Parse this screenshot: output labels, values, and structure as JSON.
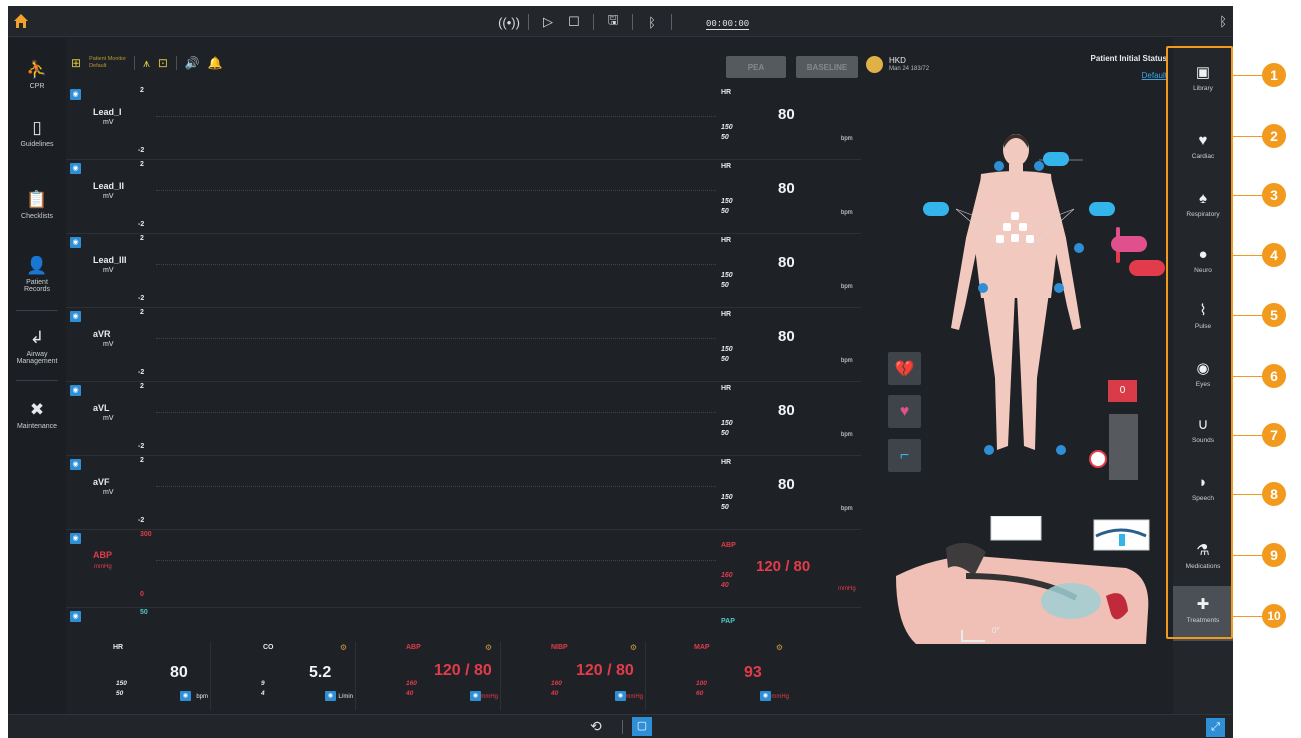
{
  "topbar": {
    "timer": "00:00:00",
    "icons": [
      "home-icon",
      "signal-icon",
      "play-icon",
      "stop-icon",
      "save-icon",
      "bluetooth-icon"
    ]
  },
  "leftnav": {
    "items": [
      {
        "label": "CPR",
        "icon": "cpr-icon"
      },
      {
        "label": "Guidelines",
        "icon": "guidelines-icon"
      },
      {
        "label": "Checklists",
        "icon": "checklist-icon"
      },
      {
        "label": "Patient Records",
        "icon": "patient-records-icon"
      },
      {
        "label": "Airway Management",
        "icon": "airway-icon"
      },
      {
        "label": "Maintenance",
        "icon": "wrench-icon"
      }
    ]
  },
  "monitor": {
    "layout_label": "Patient Monitor",
    "layout_sub": "Default",
    "pea_label": "PEA",
    "baseline_label": "BASELINE"
  },
  "waves": [
    {
      "name": "Lead_I",
      "unit": "mV",
      "top": "2",
      "bottom": "-2",
      "param": "HR",
      "hi": "150",
      "lo": "50",
      "value": "80",
      "punit": "bpm"
    },
    {
      "name": "Lead_II",
      "unit": "mV",
      "top": "2",
      "bottom": "-2",
      "param": "HR",
      "hi": "150",
      "lo": "50",
      "value": "80",
      "punit": "bpm"
    },
    {
      "name": "Lead_III",
      "unit": "mV",
      "top": "2",
      "bottom": "-2",
      "param": "HR",
      "hi": "150",
      "lo": "50",
      "value": "80",
      "punit": "bpm"
    },
    {
      "name": "aVR",
      "unit": "mV",
      "top": "2",
      "bottom": "-2",
      "param": "HR",
      "hi": "150",
      "lo": "50",
      "value": "80",
      "punit": "bpm"
    },
    {
      "name": "aVL",
      "unit": "mV",
      "top": "2",
      "bottom": "-2",
      "param": "HR",
      "hi": "150",
      "lo": "50",
      "value": "80",
      "punit": "bpm"
    },
    {
      "name": "aVF",
      "unit": "mV",
      "top": "2",
      "bottom": "-2",
      "param": "HR",
      "hi": "150",
      "lo": "50",
      "value": "80",
      "punit": "bpm"
    },
    {
      "name": "ABP",
      "unit": "mmHg",
      "top": "300",
      "bottom": "0",
      "param": "ABP",
      "hi": "160",
      "lo": "40",
      "value": "120 / 80",
      "punit": "mmHg"
    }
  ],
  "pap": {
    "top": "50",
    "param": "PAP"
  },
  "bottom_params": [
    {
      "name": "HR",
      "value": "80",
      "hi": "150",
      "lo": "50",
      "unit": "bpm"
    },
    {
      "name": "CO",
      "value": "5.2",
      "hi": "9",
      "lo": "4",
      "unit": "L/min"
    },
    {
      "name": "ABP",
      "value": "120 / 80",
      "hi": "160",
      "lo": "40",
      "unit": "mmHg"
    },
    {
      "name": "NIBP",
      "value": "120 / 80",
      "hi": "160",
      "lo": "40",
      "unit": "mmHg"
    },
    {
      "name": "MAP",
      "value": "93",
      "hi": "100",
      "lo": "60",
      "unit": "mmHg"
    }
  ],
  "patient": {
    "id": "HKD",
    "info": "Man 24 183/72",
    "status_title": "Patient Initial Status",
    "status_value": "Default",
    "gauge_value": "0",
    "head_angle": "0°"
  },
  "rightpanel": {
    "items": [
      {
        "label": "Library",
        "icon": "library-icon"
      },
      {
        "label": "Cardiac",
        "icon": "heart-icon"
      },
      {
        "label": "Respiratory",
        "icon": "lungs-icon"
      },
      {
        "label": "Neuro",
        "icon": "brain-icon"
      },
      {
        "label": "Pulse",
        "icon": "pulse-icon"
      },
      {
        "label": "Eyes",
        "icon": "eye-icon"
      },
      {
        "label": "Sounds",
        "icon": "stethoscope-icon"
      },
      {
        "label": "Speech",
        "icon": "speech-icon"
      },
      {
        "label": "Medications",
        "icon": "medication-icon"
      },
      {
        "label": "Treatments",
        "icon": "treatment-icon"
      }
    ]
  },
  "callouts": [
    "1",
    "2",
    "3",
    "4",
    "5",
    "6",
    "7",
    "8",
    "9",
    "10"
  ],
  "colors": {
    "accent": "#f29a1d",
    "blue": "#2f8fd6",
    "alarm_red": "#e23b4b",
    "background": "#1e2226"
  }
}
